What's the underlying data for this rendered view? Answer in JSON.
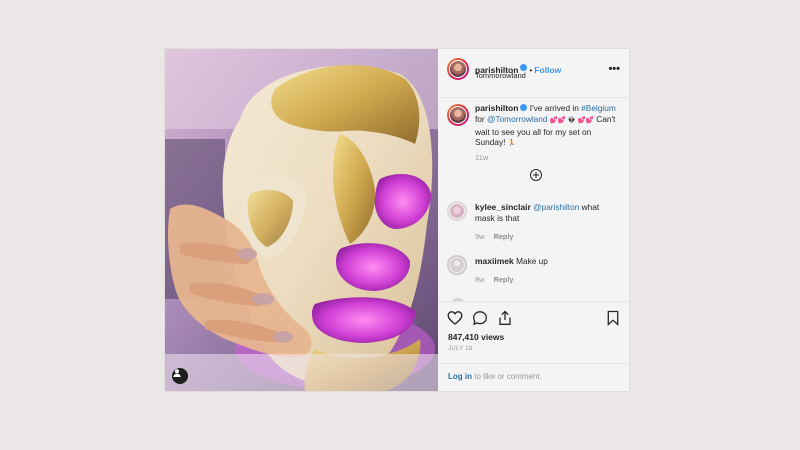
{
  "post": {
    "author": {
      "username": "parishilton",
      "verified": true,
      "follow_label": "Follow",
      "separator": "•",
      "location": "Tommorowland"
    },
    "more_icon": "more-options-icon",
    "caption": {
      "username": "parishilton",
      "text_1": "I've arrived in",
      "hashtag": "#Belgium",
      "text_2": "for",
      "mention": "@Tomorrowland",
      "emojis_1": "💕💕 👽 💕💕",
      "text_3": "Can't wait to see you all for my set on Sunday!",
      "emojis_2": "🏃",
      "time": "11w"
    },
    "load_more_icon": "plus-circle-icon",
    "comments": [
      {
        "username": "kylee_sinclair",
        "mention": "@parishilton",
        "text": "what mask is that",
        "time": "9w",
        "reply_label": "Reply"
      },
      {
        "username": "maxiimek",
        "text": "Make up",
        "time": "8w",
        "reply_label": "Reply"
      }
    ],
    "actions": [
      "heart-icon",
      "comment-icon",
      "share-icon",
      "bookmark-icon"
    ],
    "views": "847,410 views",
    "date": "JULY 18",
    "login": {
      "link": "Log in",
      "text": "to like or comment."
    }
  },
  "colors": {
    "background": "#ebe7e6",
    "panel": "#f5f4f4",
    "link": "#2d6ea6",
    "follow": "#3897f0",
    "muted": "#999999",
    "mask_gold": "#e0c56e",
    "mask_magenta": "#d44fd8"
  }
}
